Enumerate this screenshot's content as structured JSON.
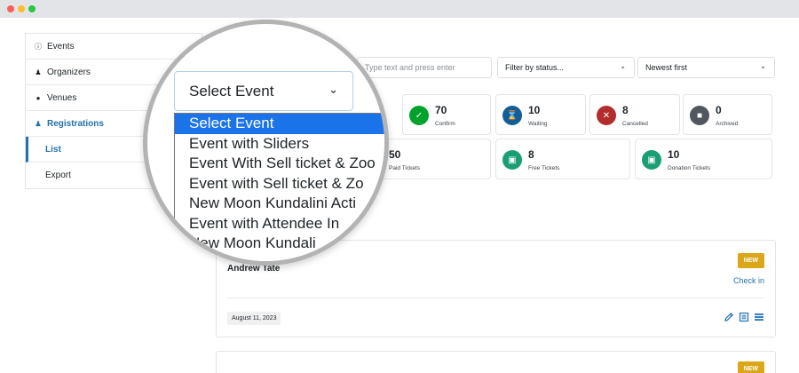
{
  "sidebar": {
    "items": [
      {
        "label": "Events",
        "icon": "info-circle-icon"
      },
      {
        "label": "Organizers",
        "icon": "person-icon"
      },
      {
        "label": "Venues",
        "icon": "map-pin-icon"
      },
      {
        "label": "Registrations",
        "icon": "group-icon"
      },
      {
        "label": "List"
      },
      {
        "label": "Export"
      }
    ]
  },
  "toolbar": {
    "search_placeholder": "Type text and press enter",
    "status_filter": "Filter by status...",
    "sort": "Newest first",
    "event_select": "Select Event"
  },
  "event_options": [
    "Select Event",
    "Event with Sliders",
    "Event With Sell ticket & Zoo",
    "Event with Sell ticket & Zo",
    "New Moon Kundalini Acti",
    "Event with Attendee In",
    "New Moon Kundali"
  ],
  "stats": [
    {
      "value": "70",
      "label": "Confirm",
      "color": "#00a32a",
      "icon": "check-user-icon"
    },
    {
      "value": "10",
      "label": "Waiting",
      "color": "#135e96",
      "icon": "hourglass-icon"
    },
    {
      "value": "8",
      "label": "Cancelled",
      "color": "#b32d2e",
      "icon": "cancel-user-icon"
    },
    {
      "value": "0",
      "label": "Archived",
      "color": "#50575e",
      "icon": "archive-icon"
    },
    {
      "value": "50",
      "label": "Paid Tickets"
    },
    {
      "value": "8",
      "label": "Free Tickets",
      "color": "#1a9e76",
      "icon": "gift-icon"
    },
    {
      "value": "10",
      "label": "Donation Tickets",
      "color": "#1a9e76",
      "icon": "gift-icon"
    }
  ],
  "registrations": [
    {
      "attendee": "Andrew Tate",
      "badge": "NEW",
      "action": "Check in",
      "date": "August 11, 2023"
    },
    {
      "badge": "NEW"
    }
  ],
  "colors": {
    "accent": "#2271b1",
    "badge": "#dba617",
    "highlight": "#1a73e8"
  }
}
